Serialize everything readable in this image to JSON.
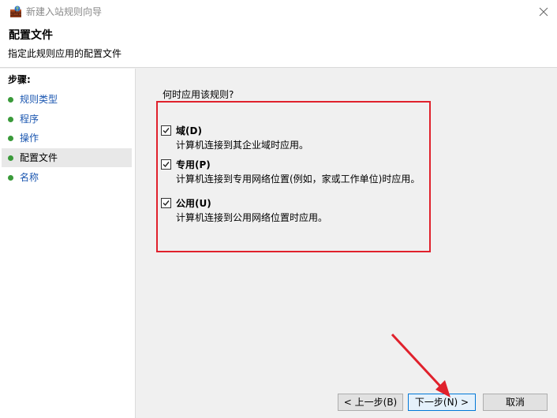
{
  "window": {
    "title": "新建入站规则向导"
  },
  "header": {
    "title": "配置文件",
    "subtitle": "指定此规则应用的配置文件"
  },
  "sidebar": {
    "steps_label": "步骤:",
    "items": [
      {
        "label": "规则类型"
      },
      {
        "label": "程序"
      },
      {
        "label": "操作"
      },
      {
        "label": "配置文件"
      },
      {
        "label": "名称"
      }
    ]
  },
  "main": {
    "question": "何时应用该规则?",
    "options": [
      {
        "title": "域(D)",
        "desc": "计算机连接到其企业域时应用。",
        "checked": true
      },
      {
        "title": "专用(P)",
        "desc": "计算机连接到专用网络位置(例如，家或工作单位)时应用。",
        "checked": true
      },
      {
        "title": "公用(U)",
        "desc": "计算机连接到公用网络位置时应用。",
        "checked": true
      }
    ]
  },
  "footer": {
    "back_label": "< 上一步(B)",
    "next_label": "下一步(N) >",
    "cancel_label": "取消"
  },
  "colors": {
    "highlight": "#e0212c",
    "step_dot": "#3a9a3a",
    "link": "#1a56b0"
  }
}
